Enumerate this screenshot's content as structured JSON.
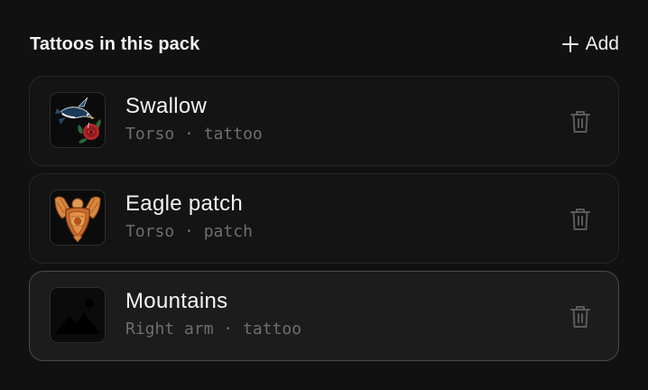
{
  "header": {
    "title": "Tattoos in this pack",
    "add_label": "Add"
  },
  "items": [
    {
      "name": "Swallow",
      "placement": "Torso",
      "kind": "tattoo",
      "thumbnail_icon": "swallow-rose-image",
      "selected": false
    },
    {
      "name": "Eagle patch",
      "placement": "Torso",
      "kind": "patch",
      "thumbnail_icon": "eagle-patch-image",
      "selected": false
    },
    {
      "name": "Mountains",
      "placement": "Right arm",
      "kind": "tattoo",
      "thumbnail_icon": "image-placeholder-icon",
      "selected": true
    }
  ],
  "separator": "·",
  "colors": {
    "background": "#111111",
    "card": "#141414",
    "card_selected": "#1c1c1c",
    "border": "#262626",
    "border_selected": "#4a4a4a",
    "text_primary": "#f3f3f3",
    "text_secondary": "#6e6e6e",
    "icon_muted": "#5a5a5a"
  }
}
